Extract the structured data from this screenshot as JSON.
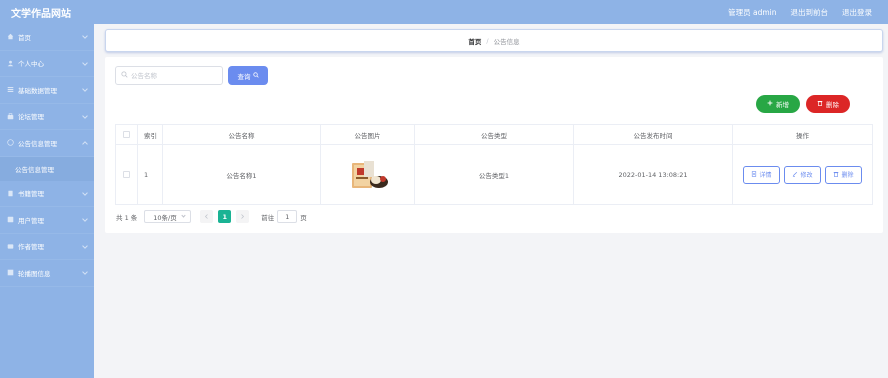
{
  "header": {
    "title": "文学作品网站",
    "admin_label": "管理员 admin",
    "back_label": "退出到前台",
    "logout_label": "退出登录"
  },
  "sidebar": {
    "items": [
      {
        "label": "首页",
        "icon": "home-icon"
      },
      {
        "label": "个人中心",
        "icon": "user-icon"
      },
      {
        "label": "基础数据管理",
        "icon": "list-icon"
      },
      {
        "label": "论坛管理",
        "icon": "forum-icon"
      },
      {
        "label": "公告信息管理",
        "icon": "notice-icon"
      },
      {
        "label": "书籍管理",
        "icon": "book-icon"
      },
      {
        "label": "用户管理",
        "icon": "users-icon"
      },
      {
        "label": "作者管理",
        "icon": "author-icon"
      },
      {
        "label": "轮播图信息",
        "icon": "image-icon"
      }
    ],
    "subitem": "公告信息管理"
  },
  "breadcrumb": {
    "home": "首页",
    "separator": "/",
    "current": "公告信息"
  },
  "search": {
    "placeholder": "公告名称",
    "query_label": "查询"
  },
  "actions": {
    "add_label": "新增",
    "delete_label": "删除"
  },
  "table": {
    "headers": {
      "index": "索引",
      "name": "公告名称",
      "picture": "公告图片",
      "type": "公告类型",
      "date": "公告发布时间",
      "ops": "操作"
    },
    "rows": [
      {
        "index": "1",
        "name": "公告名称1",
        "type": "公告类型1",
        "date": "2022-01-14 13:08:21",
        "details_label": "详情",
        "edit_label": "修改",
        "delete_label": "删除"
      }
    ]
  },
  "pagination": {
    "total": "共 1 条",
    "page_size": "10条/页",
    "current_page": "1",
    "goto_label": "前往",
    "goto_value": "1",
    "page_suffix": "页"
  },
  "colors": {
    "sidebar": "#8eb3e6",
    "primary": "#6b8cef",
    "add": "#28a745",
    "delete": "#dc2626",
    "page_active": "#1ab394"
  }
}
